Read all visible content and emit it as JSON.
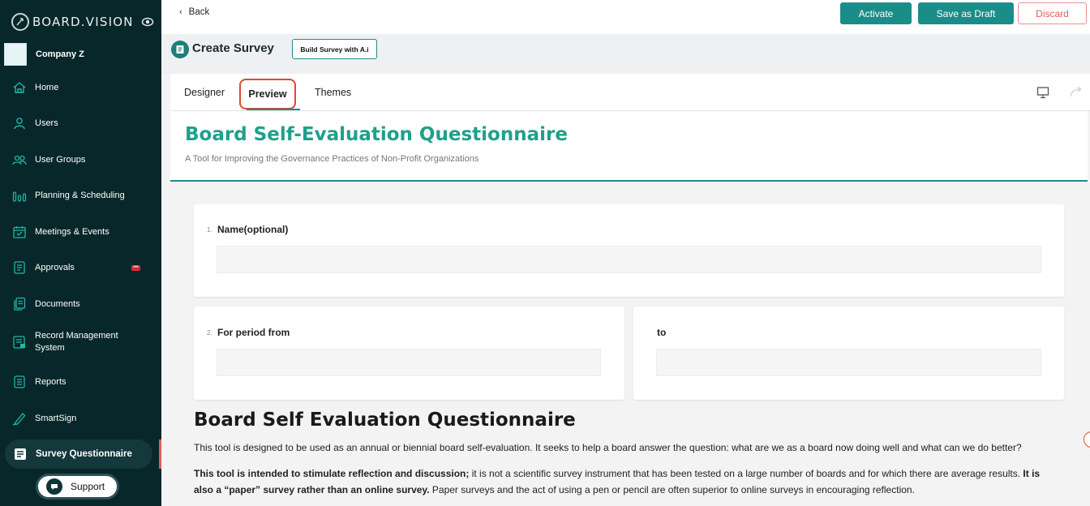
{
  "brand": {
    "name": "BOARD.VISION"
  },
  "company": {
    "name": "Company Z"
  },
  "sidebar": {
    "items": [
      {
        "label": "Home",
        "icon": "home-icon"
      },
      {
        "label": "Users",
        "icon": "user-icon"
      },
      {
        "label": "User Groups",
        "icon": "user-groups-icon"
      },
      {
        "label": "Planning & Scheduling",
        "icon": "bar-chart-icon"
      },
      {
        "label": "Meetings & Events",
        "icon": "calendar-icon"
      },
      {
        "label": "Approvals",
        "icon": "approvals-icon",
        "badge": "•••"
      },
      {
        "label": "Documents",
        "icon": "documents-icon"
      },
      {
        "label": "Record Management System",
        "icon": "record-icon"
      },
      {
        "label": "Reports",
        "icon": "reports-icon"
      },
      {
        "label": "SmartSign",
        "icon": "pen-icon"
      },
      {
        "label": "Survey Questionnaire",
        "icon": "survey-icon",
        "active": true
      }
    ],
    "support_label": "Support"
  },
  "topbar": {
    "back_label": "Back",
    "activate_label": "Activate",
    "draft_label": "Save as Draft",
    "discard_label": "Discard"
  },
  "page_header": {
    "title": "Create Survey",
    "ai_button_label": "Build Survey with A.i"
  },
  "tabs": {
    "designer": "Designer",
    "preview": "Preview",
    "themes": "Themes",
    "active": "Preview"
  },
  "survey": {
    "title": "Board Self-Evaluation Questionnaire",
    "description": "A Tool for Improving the Governance Practices of Non-Profit Organizations",
    "questions": [
      {
        "num": "1.",
        "label": "Name(optional)",
        "value": ""
      },
      {
        "num": "2.",
        "label": "For period from",
        "value": ""
      },
      {
        "num": "",
        "label": "to",
        "value": ""
      }
    ],
    "section_title": "Board Self Evaluation Questionnaire",
    "para1": "This tool is designed to be used as an annual or biennial board self-evaluation. It seeks to help a board answer the question: what are we as a board now doing well and what can we do better?",
    "para2_bold1": "This tool is intended to stimulate reflection and discussion;",
    "para2_text1": " it is not a scientific survey instrument that has been tested on a large number of boards and for which there are average results. ",
    "para2_bold2": "It is also a “paper” survey rather than an online survey.",
    "para2_text2": " Paper surveys and the act of using a pen or pencil are often superior to online surveys in encouraging reflection."
  },
  "colors": {
    "sidebar_bg": "#08272a",
    "accent": "#1b8d88",
    "title_green": "#1fa08b",
    "discard_red": "#e25b5b",
    "highlight": "#e04a2c"
  }
}
